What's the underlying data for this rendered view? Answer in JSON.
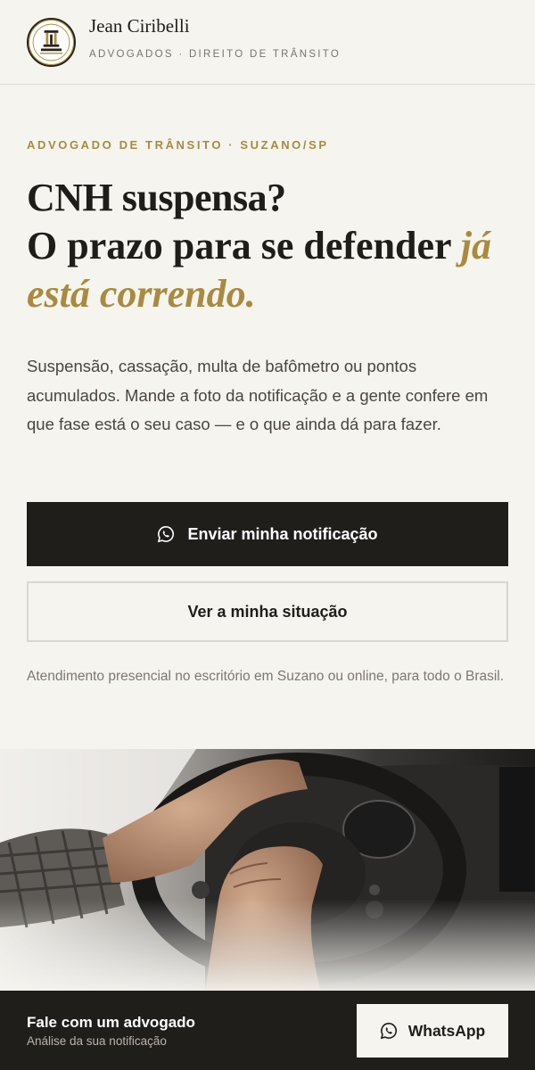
{
  "header": {
    "brand_name": "Jean Ciribelli",
    "brand_sub": "ADVOGADOS · DIREITO DE TRÂNSITO",
    "logo_text": "JEAN CIRIBELLI"
  },
  "hero": {
    "eyebrow": "ADVOGADO DE TRÂNSITO · SUZANO/SP",
    "headline_line1": "CNH suspensa?",
    "headline_line2": "O prazo para se defender ",
    "headline_highlight": "já está correndo.",
    "lead": "Suspensão, cassação, multa de bafômetro ou pontos acumulados. Mande a foto da notificação e a gente confere em que fase está o seu caso — e o que ainda dá para fazer.",
    "primary_button": "Enviar minha notificação",
    "secondary_button": "Ver a minha situação",
    "note": "Atendimento presencial no escritório em Suzano ou online, para todo o Brasil."
  },
  "bottom_bar": {
    "title": "Fale com um advogado",
    "subtitle": "Análise da sua notificação",
    "button": "WhatsApp"
  },
  "colors": {
    "background": "#f5f4ef",
    "accent_gold": "#a98a3f",
    "dark": "#201e1b"
  },
  "icons": {
    "primary_button_icon": "whatsapp-icon",
    "bottom_button_icon": "whatsapp-icon"
  }
}
